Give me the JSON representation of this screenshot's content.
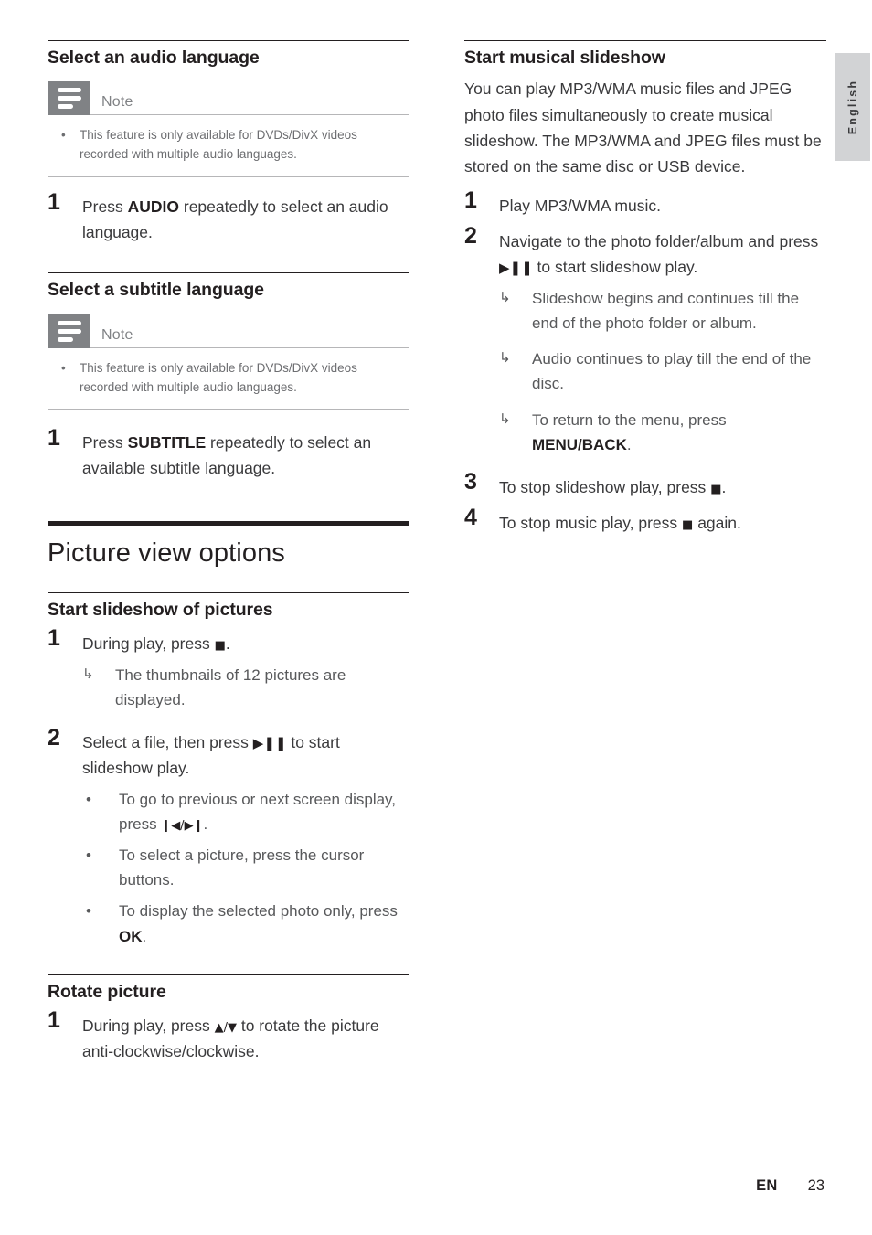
{
  "language_tab": {
    "label": "English"
  },
  "footer": {
    "language_code": "EN",
    "page_number": "23"
  },
  "left_column": {
    "sections": [
      {
        "heading": "Select an audio language",
        "note": {
          "title": "Note",
          "icon": "note-lines-icon",
          "items": [
            "This feature is only available for DVDs/DivX videos recorded with multiple audio languages."
          ]
        },
        "steps": [
          {
            "number": "1",
            "text_before": "Press ",
            "bold": "AUDIO",
            "text_after": " repeatedly to select an audio language."
          }
        ]
      },
      {
        "heading": "Select a subtitle language",
        "note": {
          "title": "Note",
          "icon": "note-lines-icon",
          "items": [
            "This feature is only available for DVDs/DivX videos recorded with multiple audio languages."
          ]
        },
        "steps": [
          {
            "number": "1",
            "text_before": "Press ",
            "bold": "SUBTITLE",
            "text_after": " repeatedly to select an available subtitle language."
          }
        ]
      }
    ],
    "chapter_title": "Picture view options",
    "subsections": [
      {
        "heading": "Start slideshow of pictures",
        "step1_number": "1",
        "step1_text_before": "During play, press ",
        "step1_glyph": "■",
        "step1_text_after": ".",
        "step1_sub_mark": "↳",
        "step1_sub_text": "The thumbnails of 12 pictures are displayed.",
        "step2_number": "2",
        "step2_text_before": "Select a file, then press ",
        "step2_glyph": "▶❚❚",
        "step2_text_after": " to start slideshow play.",
        "step2_bullets": [
          {
            "mark": "•",
            "before": "To go to previous or next screen display, press ",
            "glyph": "❙◀/▶❙",
            "after": "."
          },
          {
            "mark": "•",
            "before": "To select a picture, press the cursor buttons.",
            "glyph": "",
            "after": ""
          },
          {
            "mark": "•",
            "before": "To display the selected photo only, press ",
            "bold": "OK",
            "after": "."
          }
        ]
      },
      {
        "heading": "Rotate picture",
        "step1_number": "1",
        "step1_text_before": "During play, press ",
        "step1_glyph": "▲/▼",
        "step1_text_after": " to rotate the picture anti-clockwise/clockwise."
      }
    ]
  },
  "right_column": {
    "heading": "Start musical slideshow",
    "intro": "You can play MP3/WMA music files and JPEG photo files simultaneously to create musical slideshow. The MP3/WMA and JPEG files must be stored on the same disc or USB device.",
    "steps": [
      {
        "number": "1",
        "text": "Play MP3/WMA music."
      },
      {
        "number": "2",
        "text_before": "Navigate to the photo folder/album and press ",
        "glyph": "▶❚❚",
        "text_after": " to start slideshow play."
      },
      {
        "number": "3",
        "text_before": "To stop slideshow play, press ",
        "glyph": "■",
        "text_after": "."
      },
      {
        "number": "4",
        "text_before": "To stop music play, press ",
        "glyph": "■",
        "text_after": " again."
      }
    ],
    "step2_results": [
      {
        "mark": "↳",
        "text": "Slideshow begins and continues till the end of the photo folder or album."
      },
      {
        "mark": "↳",
        "text": "Audio continues to play till the end of the disc."
      },
      {
        "mark": "↳",
        "before": "To return to the menu, press ",
        "bold": "MENU/BACK",
        "after": "."
      }
    ]
  }
}
